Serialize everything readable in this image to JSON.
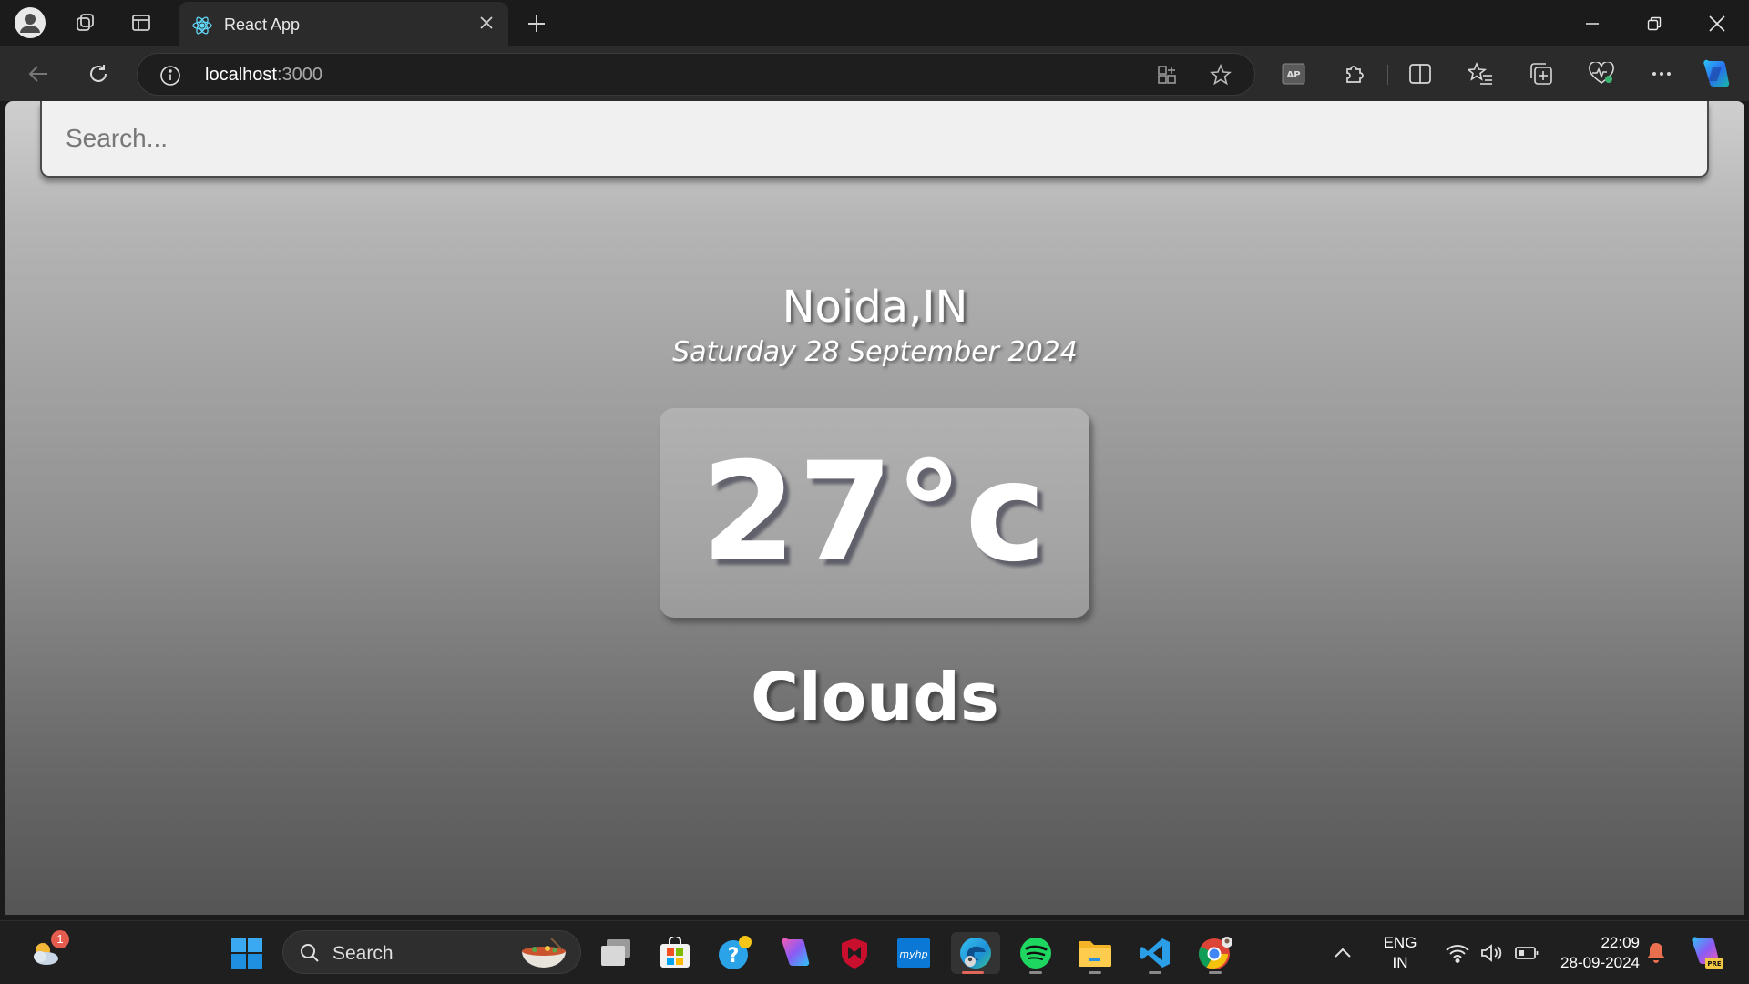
{
  "browser": {
    "tab_title": "React App",
    "url_host": "localhost",
    "url_port": ":3000"
  },
  "app": {
    "search_placeholder": "Search...",
    "location": "Noida,IN",
    "date": "Saturday 28 September 2024",
    "temperature": "27°c",
    "weather": "Clouds"
  },
  "taskbar": {
    "search_label": "Search",
    "weather_badge": "1",
    "language_line1": "ENG",
    "language_line2": "IN",
    "time": "22:09",
    "date": "28-09-2024"
  },
  "colors": {
    "accent": "#e0665a",
    "page_gradient_top": "#cfcfcf",
    "page_gradient_bottom": "#555555"
  }
}
